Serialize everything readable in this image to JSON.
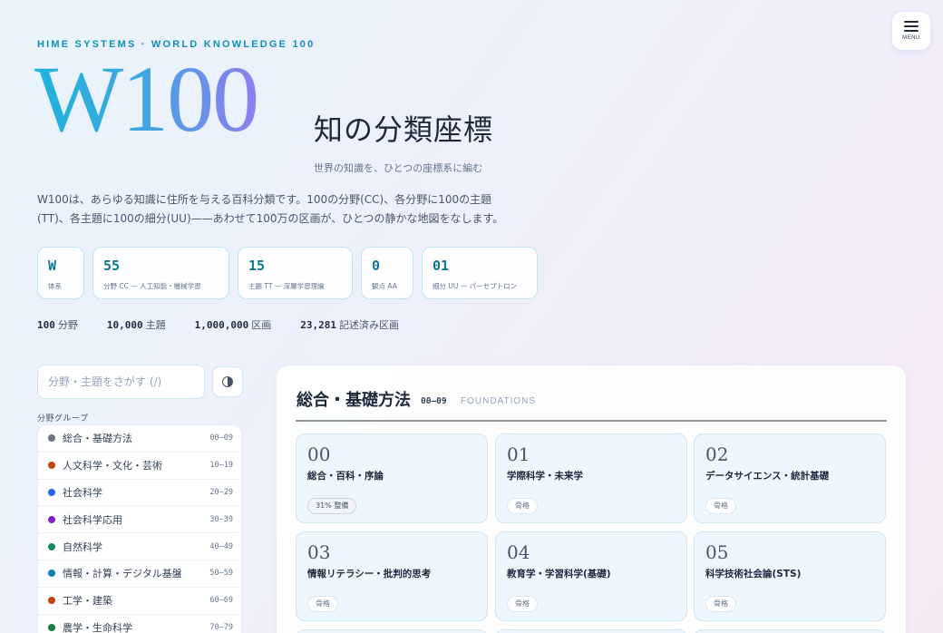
{
  "menu": {
    "label": "MENU",
    "icon": "hamburger-icon"
  },
  "brand": "HIME SYSTEMS · WORLD KNOWLEDGE 100",
  "hero": {
    "title": "W100",
    "subtitle": "知の分類座標",
    "tagline": "世界の知識を、ひとつの座標系に編む",
    "description": "W100は、あらゆる知識に住所を与える百科分類です。100の分野(CC)、各分野に100の主題(TT)、各主題に100の細分(UU)——あわせて100万の区画が、ひとつの静かな地図をなします。"
  },
  "coords": [
    {
      "value": "W",
      "label": "体系"
    },
    {
      "value": "55",
      "label": "分野 CC — 人工知能・機械学習"
    },
    {
      "value": "15",
      "label": "主題 TT — 深層学習理論"
    },
    {
      "value": "0",
      "label": "観点 AA"
    },
    {
      "value": "01",
      "label": "細分 UU — パーセプトロン"
    }
  ],
  "stats": [
    {
      "value": "100",
      "label": "分野"
    },
    {
      "value": "10,000",
      "label": "主題"
    },
    {
      "value": "1,000,000",
      "label": "区画"
    },
    {
      "value": "23,281",
      "label": "記述済み区画"
    }
  ],
  "search": {
    "placeholder": "分野・主題をさがす (/)"
  },
  "theme_toggle": {
    "icon": "contrast-icon"
  },
  "groups": {
    "heading": "分野グループ",
    "items": [
      {
        "label": "総合・基礎方法",
        "range": "00–09",
        "color": "#6b7280"
      },
      {
        "label": "人文科学・文化・芸術",
        "range": "10–19",
        "color": "#c2410c"
      },
      {
        "label": "社会科学",
        "range": "20–29",
        "color": "#2563eb"
      },
      {
        "label": "社会科学応用",
        "range": "30–39",
        "color": "#7e22ce"
      },
      {
        "label": "自然科学",
        "range": "40–49",
        "color": "#0f8a5f"
      },
      {
        "label": "情報・計算・デジタル基盤",
        "range": "50–59",
        "color": "#0e7db8"
      },
      {
        "label": "工学・建築",
        "range": "60–69",
        "color": "#c2410c"
      },
      {
        "label": "農学・生命科学",
        "range": "70–79",
        "color": "#15803d"
      }
    ]
  },
  "panel": {
    "title": "総合・基礎方法",
    "range": "00–09",
    "subtitle_en": "FOUNDATIONS",
    "cards": [
      {
        "num": "00",
        "name": "総合・百科・序論",
        "badge": "31% 整備",
        "progress": 0.31
      },
      {
        "num": "01",
        "name": "学際科学・未来学",
        "badge": "骨格"
      },
      {
        "num": "02",
        "name": "データサイエンス・統計基礎",
        "badge": "骨格"
      },
      {
        "num": "03",
        "name": "情報リテラシー・批判的思考",
        "badge": "骨格"
      },
      {
        "num": "04",
        "name": "教育学・学習科学(基礎)",
        "badge": "骨格"
      },
      {
        "num": "05",
        "name": "科学技術社会論(STS)",
        "badge": "骨格"
      }
    ]
  }
}
